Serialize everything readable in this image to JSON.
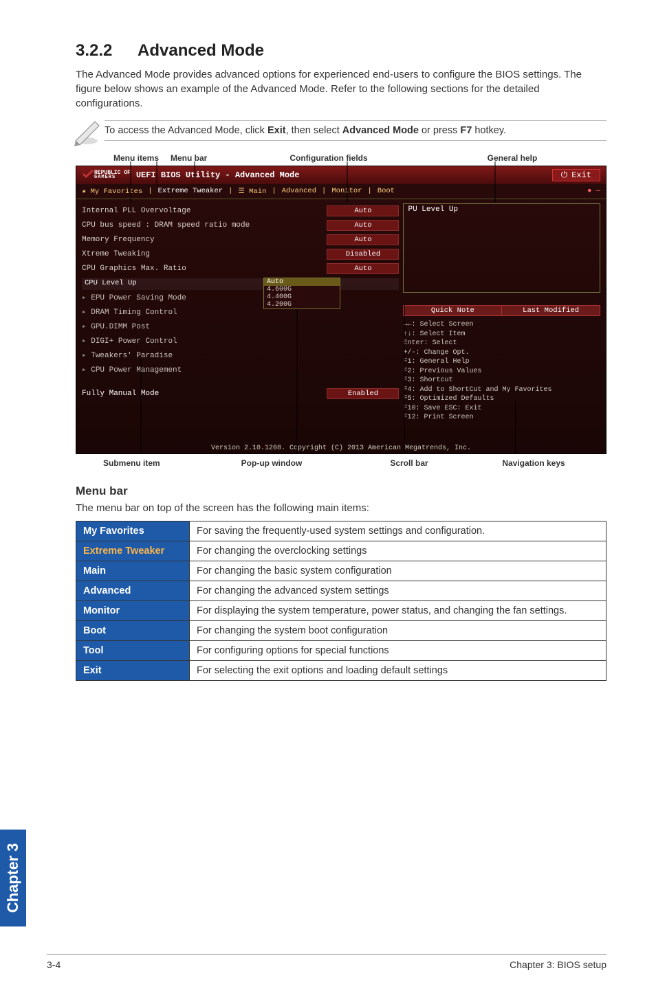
{
  "section": {
    "number": "3.2.2",
    "title": "Advanced Mode"
  },
  "intro": "The Advanced Mode provides advanced options for experienced end-users to configure the BIOS settings. The figure below shows an example of the Advanced Mode. Refer to the following sections for the detailed configurations.",
  "tip_prefix": "To access the Advanced Mode, click ",
  "tip_b1": "Exit",
  "tip_mid": ", then select ",
  "tip_b2": "Advanced Mode",
  "tip_mid2": " or press ",
  "tip_b3": "F7",
  "tip_suffix": " hotkey.",
  "top_labels": {
    "menu_items": "Menu items",
    "menu_bar": "Menu bar",
    "config_fields": "Configuration fields",
    "general_help": "General help"
  },
  "bottom_labels": {
    "submenu": "Submenu item",
    "popup": "Pop-up window",
    "scroll": "Scroll bar",
    "nav": "Navigation keys"
  },
  "bios": {
    "logo_l1": "REPUBLIC OF",
    "logo_l2": "GAMERS",
    "title": "UEFI BIOS Utility - Advanced Mode",
    "exit_icon": "⏻",
    "exit": "Exit",
    "tabs": {
      "fav": "★ My Favorites",
      "ext": "Extreme Tweaker",
      "main": "☰ Main",
      "adv": "Advanced",
      "mon": "Monitor",
      "boot": "Boot"
    },
    "right_box_title": "PU Level Up",
    "rows": {
      "r1": {
        "label": "Internal PLL Overvoltage",
        "value": "Auto"
      },
      "r2": {
        "label": "CPU bus speed : DRAM speed ratio mode",
        "value": "Auto"
      },
      "r3": {
        "label": "Memory Frequency",
        "value": "Auto"
      },
      "r4": {
        "label": "Xtreme Tweaking",
        "value": "Disabled"
      },
      "r5": {
        "label": "CPU Graphics Max. Ratio",
        "value": "Auto"
      }
    },
    "group_hdr": "CPU Level Up",
    "group_hdr_pop": "CPU Level Up",
    "sub": {
      "s1": "EPU Power Saving Mode",
      "s2": "DRAM Timing Control",
      "s3": "GPU.DIMM Post",
      "s4": "DIGI+ Power Control",
      "s5": "Tweakers' Paradise",
      "s6": "CPU Power Management"
    },
    "last_row": {
      "label": "Fully Manual Mode",
      "value": "Enabled"
    },
    "popup": {
      "h": "Auto",
      "v1": "4.600G",
      "v2": "4.400G",
      "v3": "4.200G"
    },
    "qn": {
      "a": "Quick Note",
      "b": "Last Modified"
    },
    "help_lines": {
      "l1": "→←: Select Screen",
      "l2": "↑↓: Select Item",
      "l3": "Enter: Select",
      "l4": "+/-: Change Opt.",
      "l5": "F1: General Help",
      "l6": "F2: Previous Values",
      "l7": "F3: Shortcut",
      "l8": "F4: Add to ShortCut and My Favorites",
      "l9": "F5: Optimized Defaults",
      "l10": "F10: Save   ESC: Exit",
      "l11": "F12: Print Screen"
    },
    "version": "Version 2.10.1208. Copyright (C) 2013 American Megatrends, Inc."
  },
  "menu_bar_heading": "Menu bar",
  "menu_bar_intro": "The menu bar on top of the screen has the following main items:",
  "menu_table": [
    {
      "key": "My Favorites",
      "cls": "",
      "desc": "For saving the frequently-used system settings and configuration."
    },
    {
      "key": "Extreme Tweaker",
      "cls": "ext",
      "desc": "For changing the overclocking settings"
    },
    {
      "key": "Main",
      "cls": "",
      "desc": "For changing the basic system configuration"
    },
    {
      "key": "Advanced",
      "cls": "",
      "desc": "For changing the advanced system settings"
    },
    {
      "key": "Monitor",
      "cls": "",
      "desc": "For displaying the system temperature, power status, and changing the fan settings."
    },
    {
      "key": "Boot",
      "cls": "",
      "desc": "For changing the system boot configuration"
    },
    {
      "key": "Tool",
      "cls": "",
      "desc": "For configuring options for special functions"
    },
    {
      "key": "Exit",
      "cls": "",
      "desc": "For selecting the exit options and loading default settings"
    }
  ],
  "side_tab": "Chapter 3",
  "footer_left": "3-4",
  "footer_right": "Chapter 3: BIOS setup"
}
